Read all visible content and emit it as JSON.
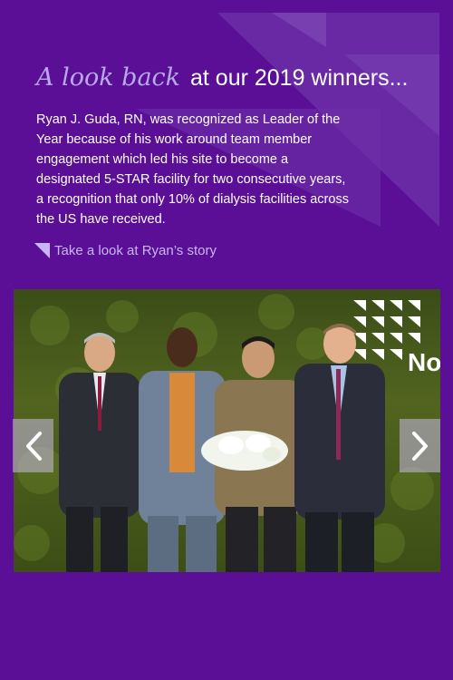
{
  "heading": {
    "script_part": "A look back",
    "rest": "at our 2019 winners..."
  },
  "body": {
    "paragraph": "Ryan J. Guda, RN, was recognized as Leader of the Year because of his work around team member engagement which led his site to become a designated 5-STAR facility for two consecutive years, a recognition that only 10% of dialysis facilities across the US have received."
  },
  "story_link": {
    "label": "Take a look at Ryan’s story",
    "icon": "triangle-arrow-icon"
  },
  "photo": {
    "backdrop_logo_text": "No He"
  },
  "carousel": {
    "prev_icon": "chevron-left-icon",
    "next_icon": "chevron-right-icon"
  },
  "colors": {
    "background": "#5a0f96",
    "accent": "#b9a8ec",
    "link": "#c7b6f3"
  }
}
